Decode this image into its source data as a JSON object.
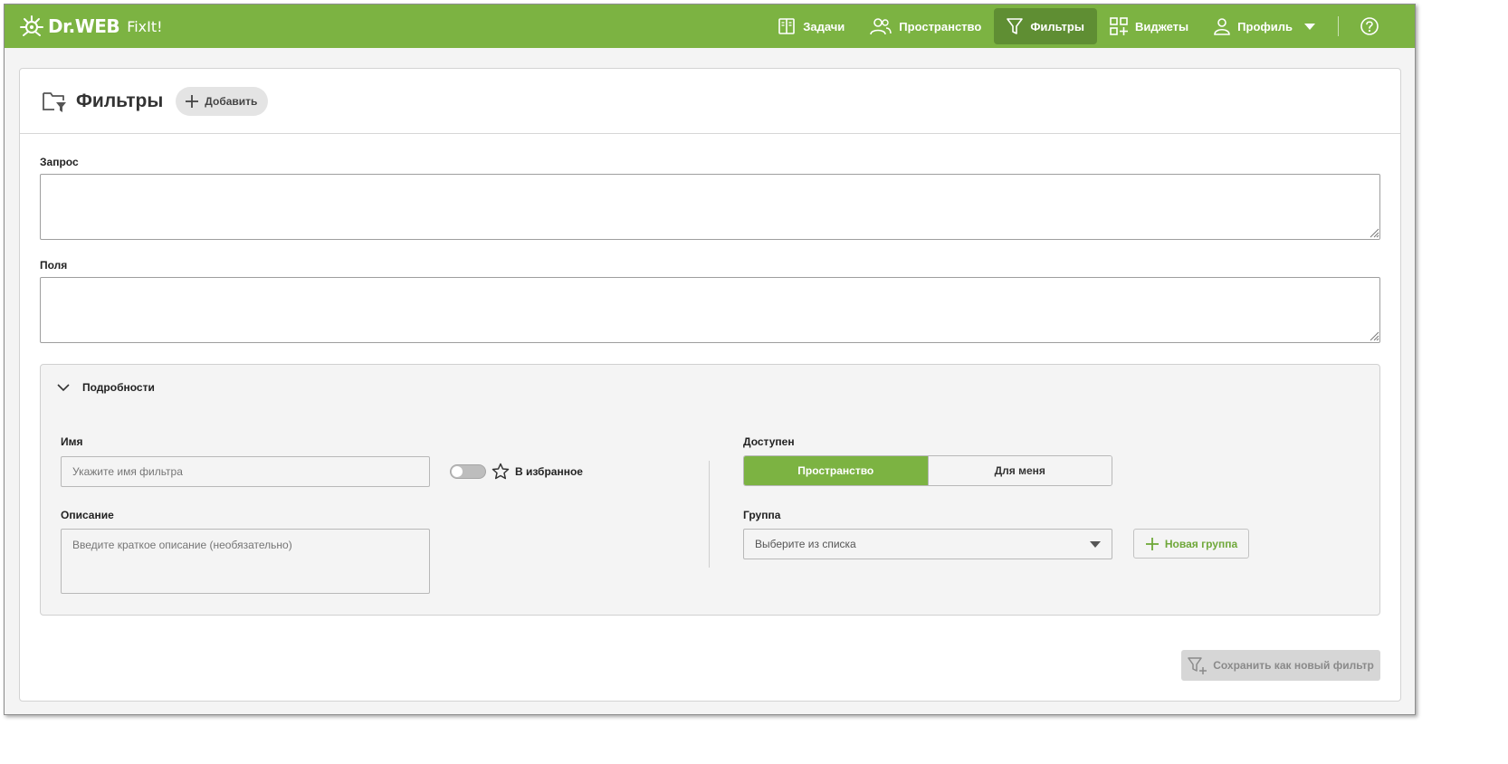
{
  "header": {
    "brand": "Dr.WEB",
    "product": "FixIt!",
    "nav": [
      {
        "id": "tasks",
        "label": "Задачи",
        "icon": "book-icon"
      },
      {
        "id": "space",
        "label": "Пространство",
        "icon": "users-icon"
      },
      {
        "id": "filters",
        "label": "Фильтры",
        "icon": "filter-icon",
        "active": true
      },
      {
        "id": "widgets",
        "label": "Виджеты",
        "icon": "widgets-icon"
      },
      {
        "id": "profile",
        "label": "Профиль",
        "icon": "user-icon"
      }
    ],
    "help_icon": "help-icon"
  },
  "page": {
    "title": "Фильтры",
    "add_label": "Добавить"
  },
  "form": {
    "query_label": "Запрос",
    "query_value": "",
    "fields_label": "Поля",
    "fields_value": "",
    "details_label": "Подробности",
    "name_label": "Имя",
    "name_placeholder": "Укажите имя фильтра",
    "favorite_label": "В избранное",
    "description_label": "Описание",
    "description_placeholder": "Введите краткое описание (необязательно)",
    "access_label": "Доступен",
    "access_options": [
      "Пространство",
      "Для меня"
    ],
    "access_selected": "Пространство",
    "group_label": "Группа",
    "group_placeholder": "Выберите из списка",
    "new_group_label": "Новая группа",
    "save_label": "Сохранить как новый фильтр"
  },
  "colors": {
    "brand_green": "#7cb342",
    "active_nav": "#5f8e33",
    "disabled": "#d6d6d6"
  }
}
